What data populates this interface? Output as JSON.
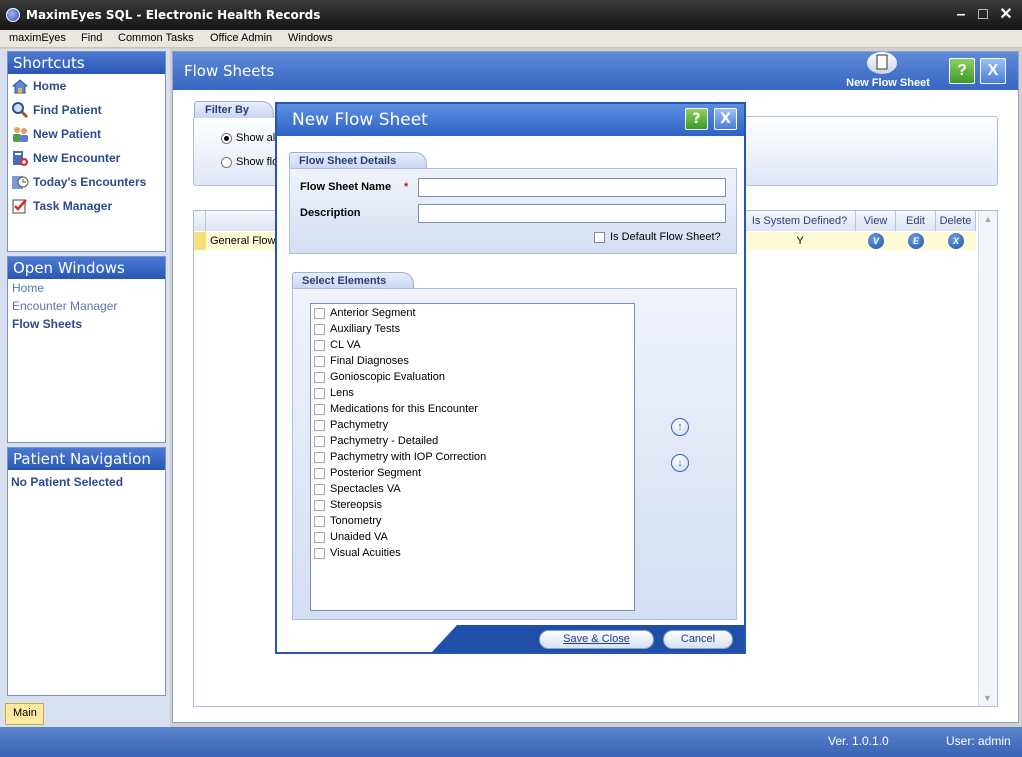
{
  "window": {
    "title": "MaximEyes SQL - Electronic Health Records"
  },
  "menu": [
    "maximEyes",
    "Find",
    "Common Tasks",
    "Office Admin",
    "Windows"
  ],
  "shortcuts": {
    "title": "Shortcuts",
    "items": [
      "Home",
      "Find Patient",
      "New Patient",
      "New Encounter",
      "Today's Encounters",
      "Task Manager"
    ]
  },
  "open_windows": {
    "title": "Open Windows",
    "items": [
      "Home",
      "Encounter Manager",
      "Flow Sheets"
    ]
  },
  "patient_navigation": {
    "title": "Patient Navigation",
    "status": "No Patient Selected"
  },
  "bottom_tab": "Main",
  "main": {
    "title": "Flow Sheets",
    "new_button": "New Flow Sheet",
    "help_label": "?",
    "close_label": "X",
    "filter": {
      "title": "Filter By",
      "opt1": "Show al",
      "opt2": "Show flo"
    },
    "grid": {
      "headers": {
        "system": "Is System Defined?",
        "view": "View",
        "edit": "Edit",
        "delete": "Delete"
      },
      "row": {
        "name": "General Flow",
        "system": "Y",
        "view_icon": "V",
        "edit_icon": "E",
        "delete_icon": "X"
      }
    }
  },
  "dialog": {
    "title": "New Flow Sheet",
    "help_label": "?",
    "close_label": "X",
    "details_tab": "Flow Sheet Details",
    "name_label": "Flow Sheet Name",
    "required_mark": "*",
    "name_value": "",
    "description_label": "Description",
    "description_value": "",
    "default_label": "Is Default Flow Sheet?",
    "elements_tab": "Select Elements",
    "elements": [
      "Anterior Segment",
      "Auxiliary Tests",
      "CL VA",
      "Final Diagnoses",
      "Gonioscopic Evaluation",
      "Lens",
      "Medications for this Encounter",
      "Pachymetry",
      "Pachymetry - Detailed",
      "Pachymetry with IOP Correction",
      "Posterior Segment",
      "Spectacles VA",
      "Stereopsis",
      "Tonometry",
      "Unaided VA",
      "Visual Acuities"
    ],
    "save_label": "Save & Close",
    "cancel_label": "Cancel"
  },
  "status": {
    "version": "Ver. 1.0.1.0",
    "user": "User: admin"
  },
  "colors": {
    "accent": "#2f63c4",
    "title_bar": "#1f1f1f",
    "selected_row": "#fffbd6"
  }
}
